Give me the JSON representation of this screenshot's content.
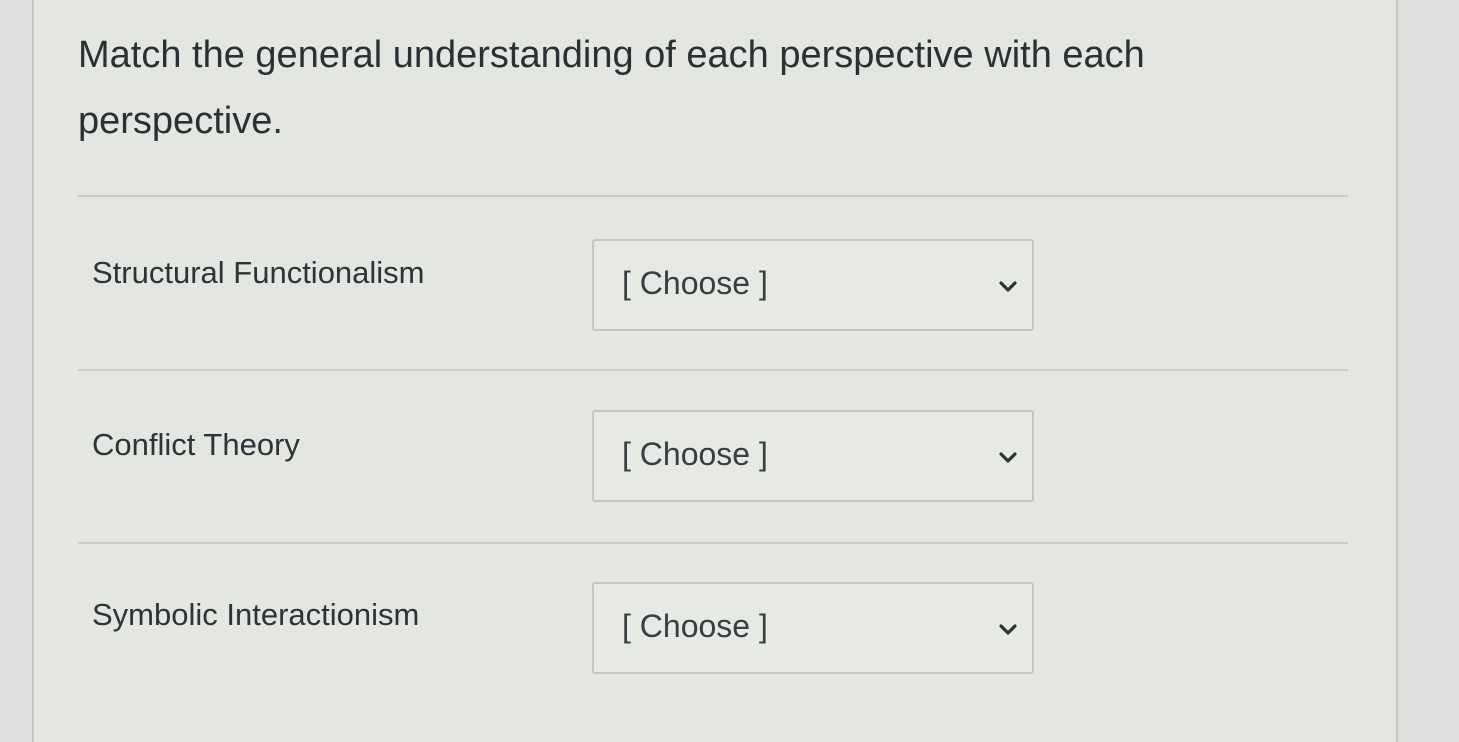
{
  "question": {
    "text": "Match the general understanding of each perspective with each perspective."
  },
  "rows": [
    {
      "label": "Structural Functionalism",
      "selected": "[ Choose ]"
    },
    {
      "label": "Conflict Theory",
      "selected": "[ Choose ]"
    },
    {
      "label": "Symbolic Interactionism",
      "selected": "[ Choose ]"
    }
  ],
  "icons": {
    "dropdown": "chevron-down-icon"
  },
  "colors": {
    "background": "#e4e6e2",
    "text": "#2c2f33",
    "border": "#c4c7c2"
  }
}
